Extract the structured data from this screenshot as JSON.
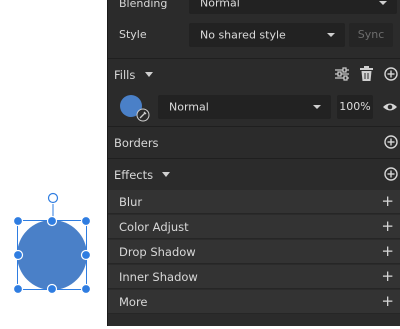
{
  "panel": {
    "blending": {
      "label": "Blending",
      "value": "Normal"
    },
    "style": {
      "label": "Style",
      "value": "No shared style",
      "sync_label": "Sync"
    },
    "fills": {
      "title": "Fills",
      "blend_mode": "Normal",
      "opacity": "100%",
      "swatch_color": "#4a80c8"
    },
    "borders": {
      "title": "Borders"
    },
    "effects": {
      "title": "Effects",
      "items": [
        {
          "label": "Blur"
        },
        {
          "label": "Color Adjust"
        },
        {
          "label": "Drop Shadow"
        },
        {
          "label": "Inner Shadow"
        },
        {
          "label": "More"
        }
      ],
      "add_symbol": "+"
    }
  },
  "canvas": {
    "shape_color": "#4a80c8",
    "selection_color": "#2f7de1"
  }
}
